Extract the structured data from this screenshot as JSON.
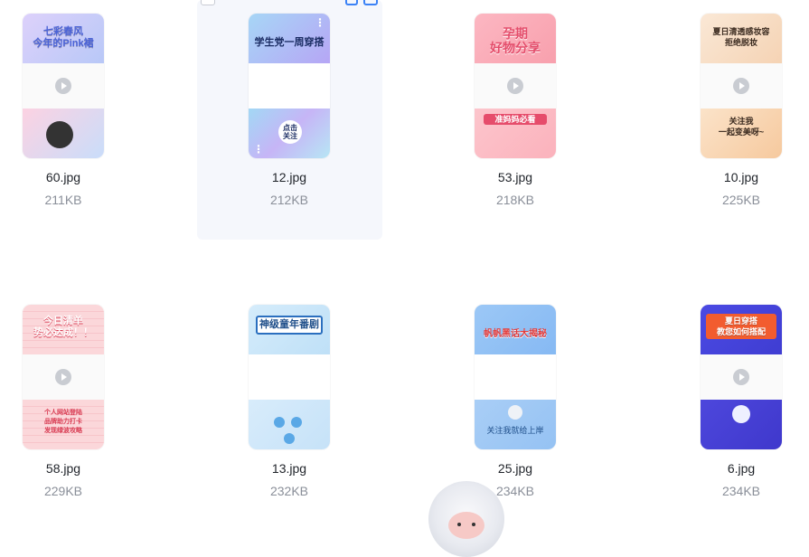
{
  "files": [
    {
      "name": "60.jpg",
      "size": "211KB",
      "top_text": "七彩春风\n今年的Pink裙",
      "bottom_text": "",
      "colors": {
        "top": "#b9a7f0",
        "bottom": "#d7e6fb",
        "accent": "#e05aa0"
      }
    },
    {
      "name": "12.jpg",
      "size": "212KB",
      "top_text": "学生党一周穿搭",
      "bottom_text": "点击\n关注",
      "colors": {
        "top": "#9ad8f3",
        "bottom": "#a9d7f6",
        "accent": "#7a6cf0"
      }
    },
    {
      "name": "53.jpg",
      "size": "218KB",
      "top_text": "孕期\n好物分享",
      "bottom_text": "准妈妈必看",
      "colors": {
        "top": "#f7a8b3",
        "bottom": "#fbc1c8",
        "accent": "#e24f6b"
      }
    },
    {
      "name": "10.jpg",
      "size": "225KB",
      "top_text": "夏日清透感妆容\n拒绝脱妆",
      "bottom_text": "关注我\n一起变美呀~",
      "colors": {
        "top": "#f7dcc3",
        "bottom": "#f6c79d",
        "accent": "#f0a35b"
      }
    },
    {
      "name": "58.jpg",
      "size": "229KB",
      "top_text": "今日清单\n势必达成！！",
      "bottom_text": "个人网站登陆\n品牌助力打卡\n发现绿波攻略",
      "colors": {
        "top": "#fbd4d8",
        "bottom": "#fbd4d8",
        "accent": "#ec4a5f"
      }
    },
    {
      "name": "13.jpg",
      "size": "232KB",
      "top_text": "神级童年番剧",
      "bottom_text": "",
      "colors": {
        "top": "#b9dcf7",
        "bottom": "#cde7f8",
        "accent": "#2b6fbf"
      }
    },
    {
      "name": "25.jpg",
      "size": "234KB",
      "top_text": "帆帆黑话大揭秘",
      "bottom_text": "关注我就给上岸",
      "colors": {
        "top": "#8ec3f7",
        "bottom": "#9ec9f3",
        "accent": "#f6b43d"
      }
    },
    {
      "name": "6.jpg",
      "size": "234KB",
      "top_text": "夏日穿搭\n教您如何搭配",
      "bottom_text": "",
      "colors": {
        "top": "#4a4ae0",
        "bottom": "#4c44d8",
        "accent": "#f25c2f"
      }
    }
  ]
}
